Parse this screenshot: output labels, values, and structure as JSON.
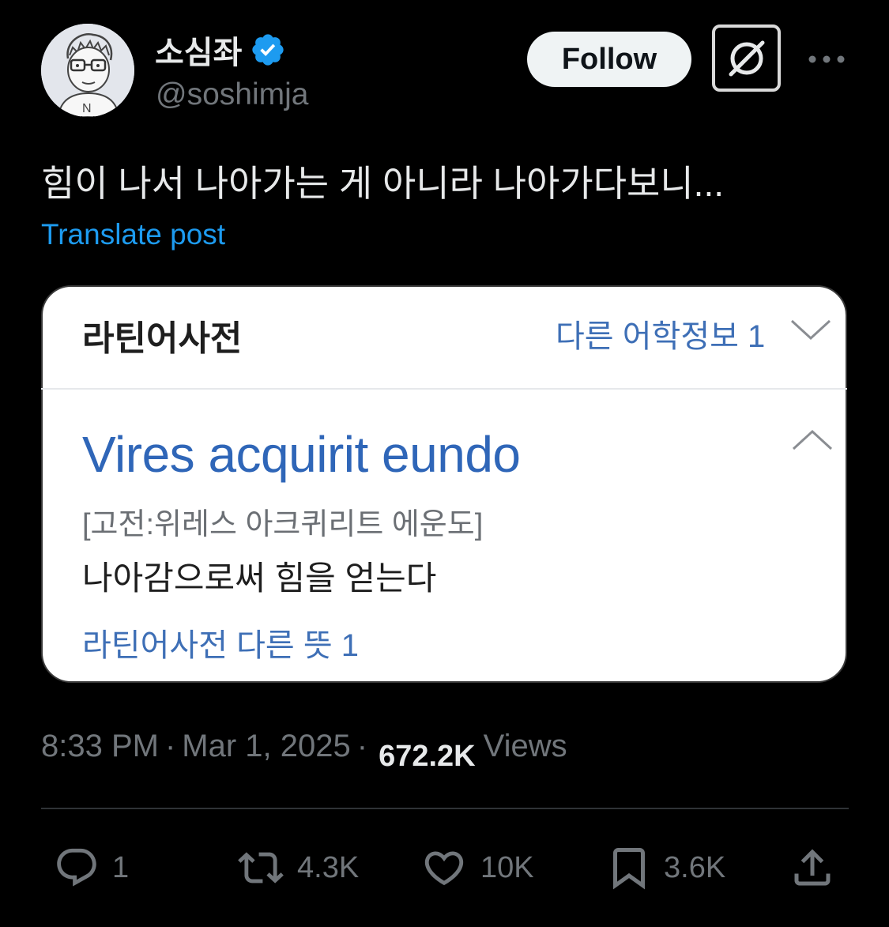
{
  "post": {
    "display_name": "소심좌",
    "handle": "@soshimja",
    "follow_label": "Follow",
    "text": "힘이 나서 나아가는 게 아니라 나아가다보니...",
    "translate_label": "Translate post",
    "time": "8:33 PM",
    "separator": "·",
    "date": "Mar 1, 2025",
    "views_count": "672.2K",
    "views_label": "Views"
  },
  "card": {
    "title": "라틴어사전",
    "more_info": "다른 어학정보 1",
    "headword": "Vires acquirit eundo",
    "pronunciation": "[고전:위레스 아크퀴리트 에운도]",
    "meaning": "나아감으로써 힘을 얻는다",
    "other_meaning": "라틴어사전 다른 뜻 1"
  },
  "actions": {
    "replies": "1",
    "reposts": "4.3K",
    "likes": "10K",
    "bookmarks": "3.6K"
  },
  "colors": {
    "background": "#000000",
    "accent": "#1d9bf0",
    "card_link": "#3e6fb6",
    "muted": "#71767b"
  }
}
